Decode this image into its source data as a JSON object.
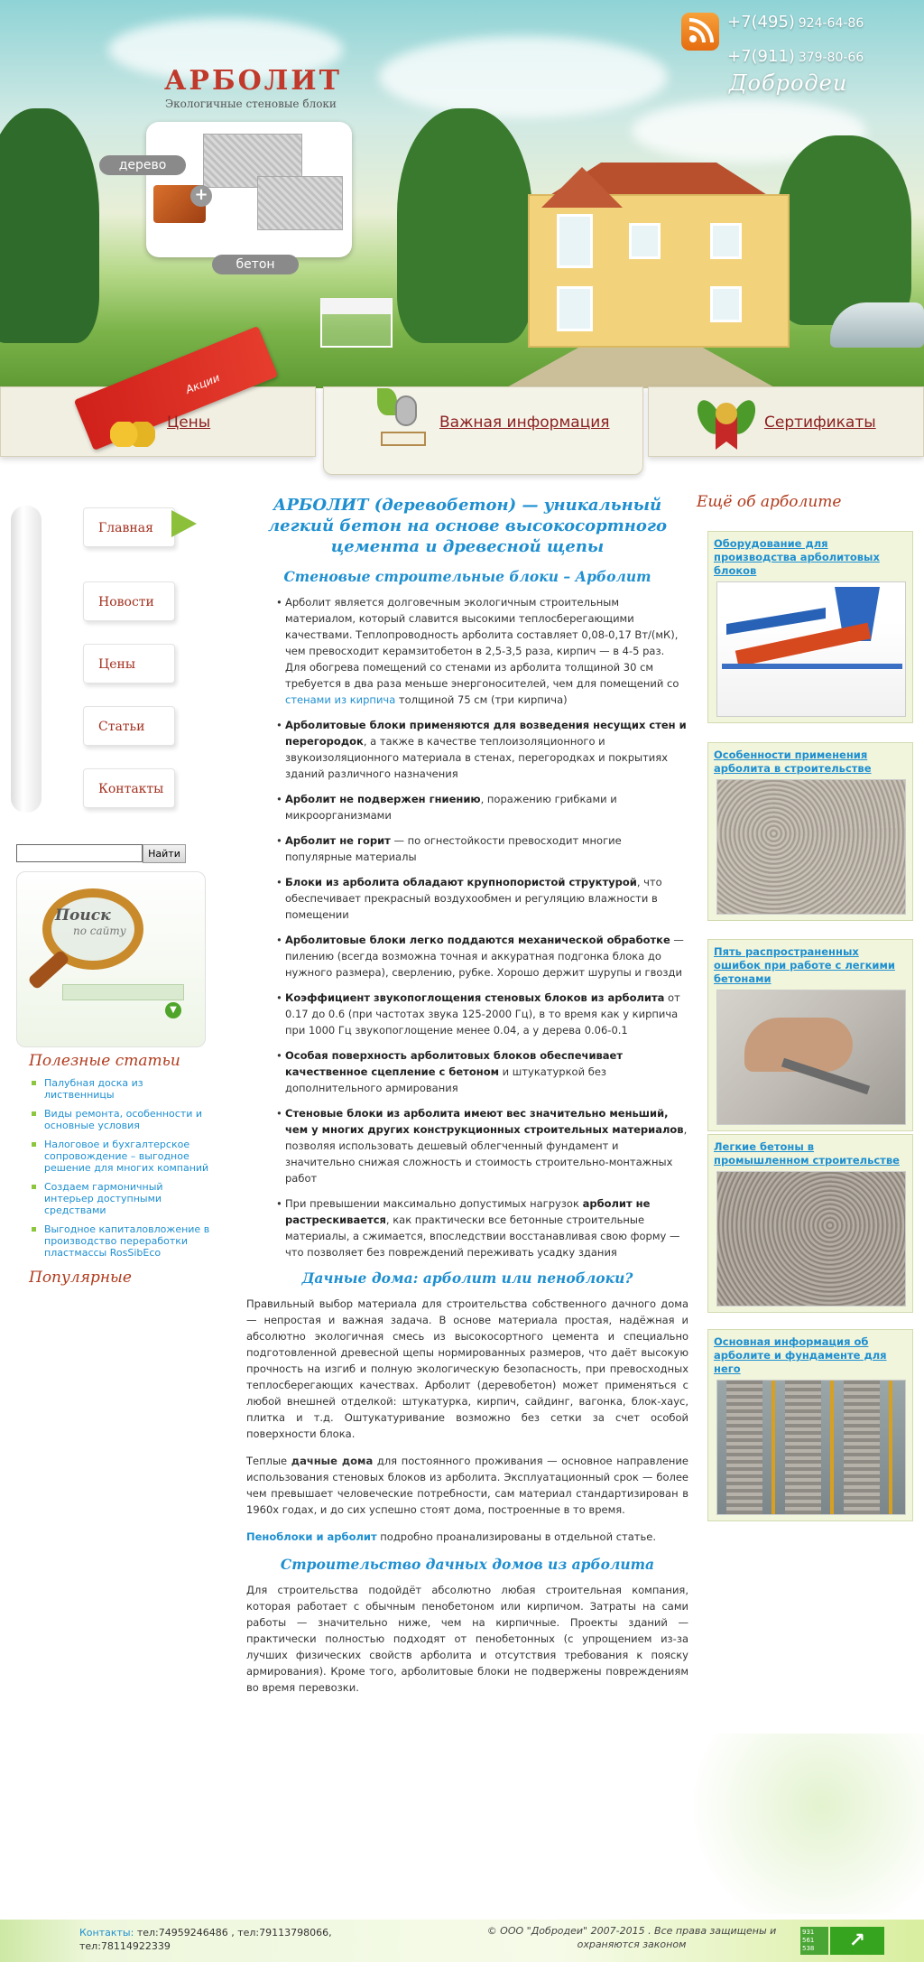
{
  "header": {
    "site_title": "АРБОЛИТ",
    "site_subtitle": "Экологичные стеновые блоки",
    "pill_wood": "дерево",
    "pill_concrete": "бетон",
    "phone1_code": "+7(495)",
    "phone1_num": "924-64-86",
    "phone2_code": "+7(911)",
    "phone2_num": "379-80-66",
    "brand": "Добродеи"
  },
  "topnav": {
    "promo": "Акции",
    "prices": "Цены",
    "info": "Важная информация",
    "certificates": "Сертификаты"
  },
  "sidebar_left": {
    "menu": [
      "Главная",
      "Новости",
      "Цены",
      "Статьи",
      "Контакты"
    ],
    "search_button": "Найти",
    "search_placeholder": "",
    "banner_title": "Поиск",
    "banner_subtitle": "по сайту",
    "useful_heading": "Полезные статьи",
    "useful_articles": [
      "Палубная доска из лиственницы",
      "Виды ремонта, особенности и основные условия",
      "Налоговое и бухгалтерское сопровождение – выгодное решение для многих компаний",
      "Создаем гармоничный интерьер доступными средствами",
      "Выгодное капиталовложение в производство переработки пластмассы RosSibEco"
    ],
    "popular_heading": "Популярные"
  },
  "main": {
    "title": "АРБОЛИТ (деревобетон) — уникальный легкий бетон на основе высокосортного цемента и древесной щепы",
    "section1_heading": "Стеновые строительные блоки – Арболит",
    "list": [
      {
        "pre": "Арболит является долговечным экологичным строительным материалом, который славится высокими теплосберегающими качествами. Теплопроводность арболита составляет 0,08-0,17 Вт/(мК), чем превосходит керамзитобетон в 2,5-3,5 раза, кирпич — в 4-5 раз. Для обогрева помещений со стенами из арболита толщиной 30 см требуется в два раза меньше энергоносителей, чем для помещений со ",
        "link": "стенами из кирпича",
        "post": " толщиной 75 см (три кирпича)"
      },
      {
        "bold": "Арболитовые блоки применяются для возведения несущих стен и перегородок",
        "post": ", а также в качестве теплоизоляционного и звукоизоляционного материала в стенах, перегородках и покрытиях зданий различного назначения"
      },
      {
        "bold": "Арболит не подвержен гниению",
        "post": ", поражению грибками и микроорганизмами"
      },
      {
        "bold": "Арболит не горит",
        "post": " — по огнестойкости превосходит многие популярные материалы"
      },
      {
        "bold": "Блоки из арболита обладают крупнопористой структурой",
        "post": ", что обеспечивает прекрасный воздухообмен и регуляцию влажности в помещении"
      },
      {
        "bold": "Арболитовые блоки легко поддаются механической обработке",
        "post": " — пилению (всегда возможна точная и аккуратная подгонка блока до нужного размера), сверлению, рубке. Хорошо держит шурупы и гвозди"
      },
      {
        "bold": "Коэффициент звукопоглощения стеновых блоков из арболита",
        "post": " от 0.17 до 0.6 (при частотах звука 125-2000 Гц), в то время как у кирпича при 1000 Гц звукопоглощение менее 0.04, а у дерева 0.06-0.1"
      },
      {
        "bold": "Особая поверхность арболитовых блоков обеспечивает качественное сцепление с бетоном",
        "post": " и штукатуркой без дополнительного армирования"
      },
      {
        "bold": "Стеновые блоки из арболита имеют вес значительно меньший, чем у многих других конструкционных строительных материалов",
        "post": ", позволяя использовать дешевый облегченный фундамент и значительно снижая сложность и стоимость строительно-монтажных работ"
      },
      {
        "pre": "При превышении максимально допустимых нагрузок ",
        "bold": "арболит не растрескивается",
        "post": ", как практически все бетонные строительные материалы, а сжимается, впоследствии восстанавливая свою форму — что позволяет без повреждений переживать усадку здания"
      }
    ],
    "section2_heading": "Дачные дома:  арболит или пеноблоки?",
    "para1": "Правильный выбор материала для строительства собственного дачного дома — непростая и важная задача. В основе материала простая, надёжная и абсолютно экологичная смесь из высокосортного цемента и специально подготовленной древесной щепы нормированных размеров, что даёт высокую прочность на изгиб и полную экологическую безопасность, при превосходных теплосберегающих качествах. Арболит (деревобетон) может применяться с любой внешней отделкой: штукатурка, кирпич, сайдинг, вагонка, блок-хаус, плитка и т.д. Оштукатуривание возможно без сетки за счет особой поверхности блока.",
    "para2_pre": "Теплые ",
    "para2_bold": "дачные дома",
    "para2_post": " для постоянного проживания — основное направление использования стеновых блоков из арболита. Эксплуатационный срок — более чем превышает человеческие потребности, сам материал стандартизирован в 1960х годах, и до сих успешно стоят дома, построенные в то время.",
    "para3_link": "Пеноблоки и арболит",
    "para3_post": " подробно проанализированы в отдельной статье.",
    "section3_heading": "Строительство дачных домов из арболита",
    "para4": "Для строительства подойдёт абсолютно любая строительная компания, которая работает с обычным пенобетоном или кирпичом. Затраты на сами работы — значительно ниже, чем на кирпичные. Проекты зданий — практически полностью подходят от пенобетонных (с упрощением из-за лучших физических свойств арболита и отсутствия требования к пояску армирования). Кроме того, арболитовые блоки не подвержены повреждениям во время перевозки."
  },
  "sidebar_right": {
    "heading": "Ещё об арболите",
    "cards": [
      "Оборудование для производства арболитовых блоков",
      "Особенности применения арболита в строительстве",
      "Пять распространенных ошибок при работе с легкими бетонами",
      "Легкие бетоны в промышленном строительстве",
      "Основная информация об арболите и фундаменте для него"
    ]
  },
  "footer": {
    "contacts_label": "Контакты:",
    "contacts_text": " тел:74959246486 , тел:79113798066, тел:78114922339",
    "copyright": "© ООО \"Добродеи\" 2007-2015 . Все права защищены и охраняются законом",
    "counter": "931\n561\n538"
  }
}
